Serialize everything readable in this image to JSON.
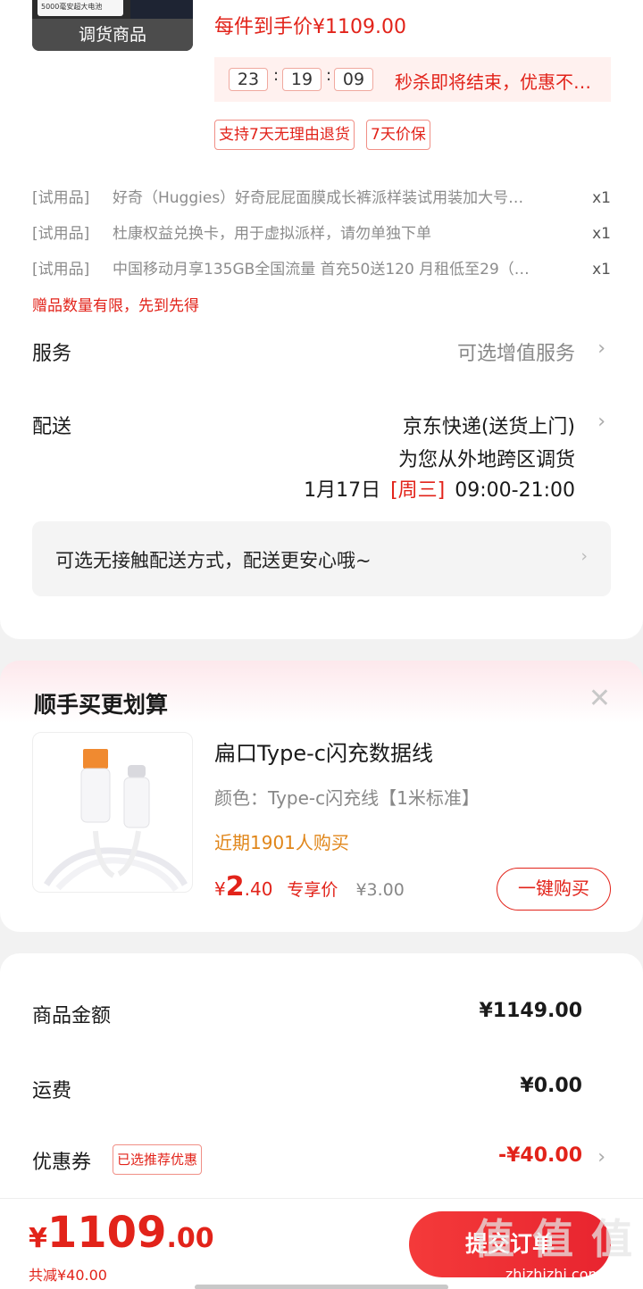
{
  "product": {
    "thumb_box_text": "5000毫安超大电池",
    "thumb_tag": "调货商品",
    "price_line": "每件到手价¥1109.00"
  },
  "seckill": {
    "hh": "23",
    "mm": "19",
    "ss": "09",
    "colon": ":",
    "text": "秒杀即将结束，优惠不…"
  },
  "badges": {
    "return": "支持7天无理由退货",
    "price_protect": "7天价保"
  },
  "gifts": [
    {
      "tag": "[试用品]",
      "name": "好奇（Huggies）好奇屁屁面膜成长裤派样装试用装加大号…",
      "qty": "x1"
    },
    {
      "tag": "[试用品]",
      "name": "杜康权益兑换卡，用于虚拟派样，请勿单独下单",
      "qty": "x1"
    },
    {
      "tag": "[试用品]",
      "name": "中国移动月享135GB全国流量 首充50送120 月租低至29（…",
      "qty": "x1"
    }
  ],
  "gift_limit": "赠品数量有限，先到先得",
  "service": {
    "label": "服务",
    "value": "可选增值服务"
  },
  "delivery": {
    "label": "配送",
    "method": "京东快递(送货上门)",
    "note": "为您从外地跨区调货",
    "date": "1月17日",
    "weekday": "[周三]",
    "time": "09:00-21:00"
  },
  "notice": "可选无接触配送方式，配送更安心哦~",
  "upsell": {
    "title": "顺手买更划算",
    "close": "✕",
    "name": "扁口Type-c闪充数据线",
    "color": "颜色：Type-c闪充线【1米标准】",
    "sales": "近期1901人购买",
    "price_cur": "¥",
    "price_int": "2",
    "price_dec": ".40",
    "price_label": "专享价",
    "orig_price": "¥3.00",
    "buy_label": "一键购买"
  },
  "summary": {
    "goods_label": "商品金额",
    "goods_value": "¥1149.00",
    "shipping_label": "运费",
    "shipping_value": "¥0.00",
    "coupon_label": "优惠券",
    "coupon_badge": "已选推荐优惠",
    "coupon_value": "-¥40.00"
  },
  "footer": {
    "total_cur": "¥",
    "total_int": "1109",
    "total_dec": ".00",
    "reduce": "共减¥40.00",
    "submit": "提交订单"
  },
  "watermark": {
    "big": "值 值 值",
    "small": "zhizhizhi.com"
  },
  "icons": {
    "chevron": "›"
  },
  "colors": {
    "accent": "#e2231a",
    "sales": "#e0861a"
  }
}
